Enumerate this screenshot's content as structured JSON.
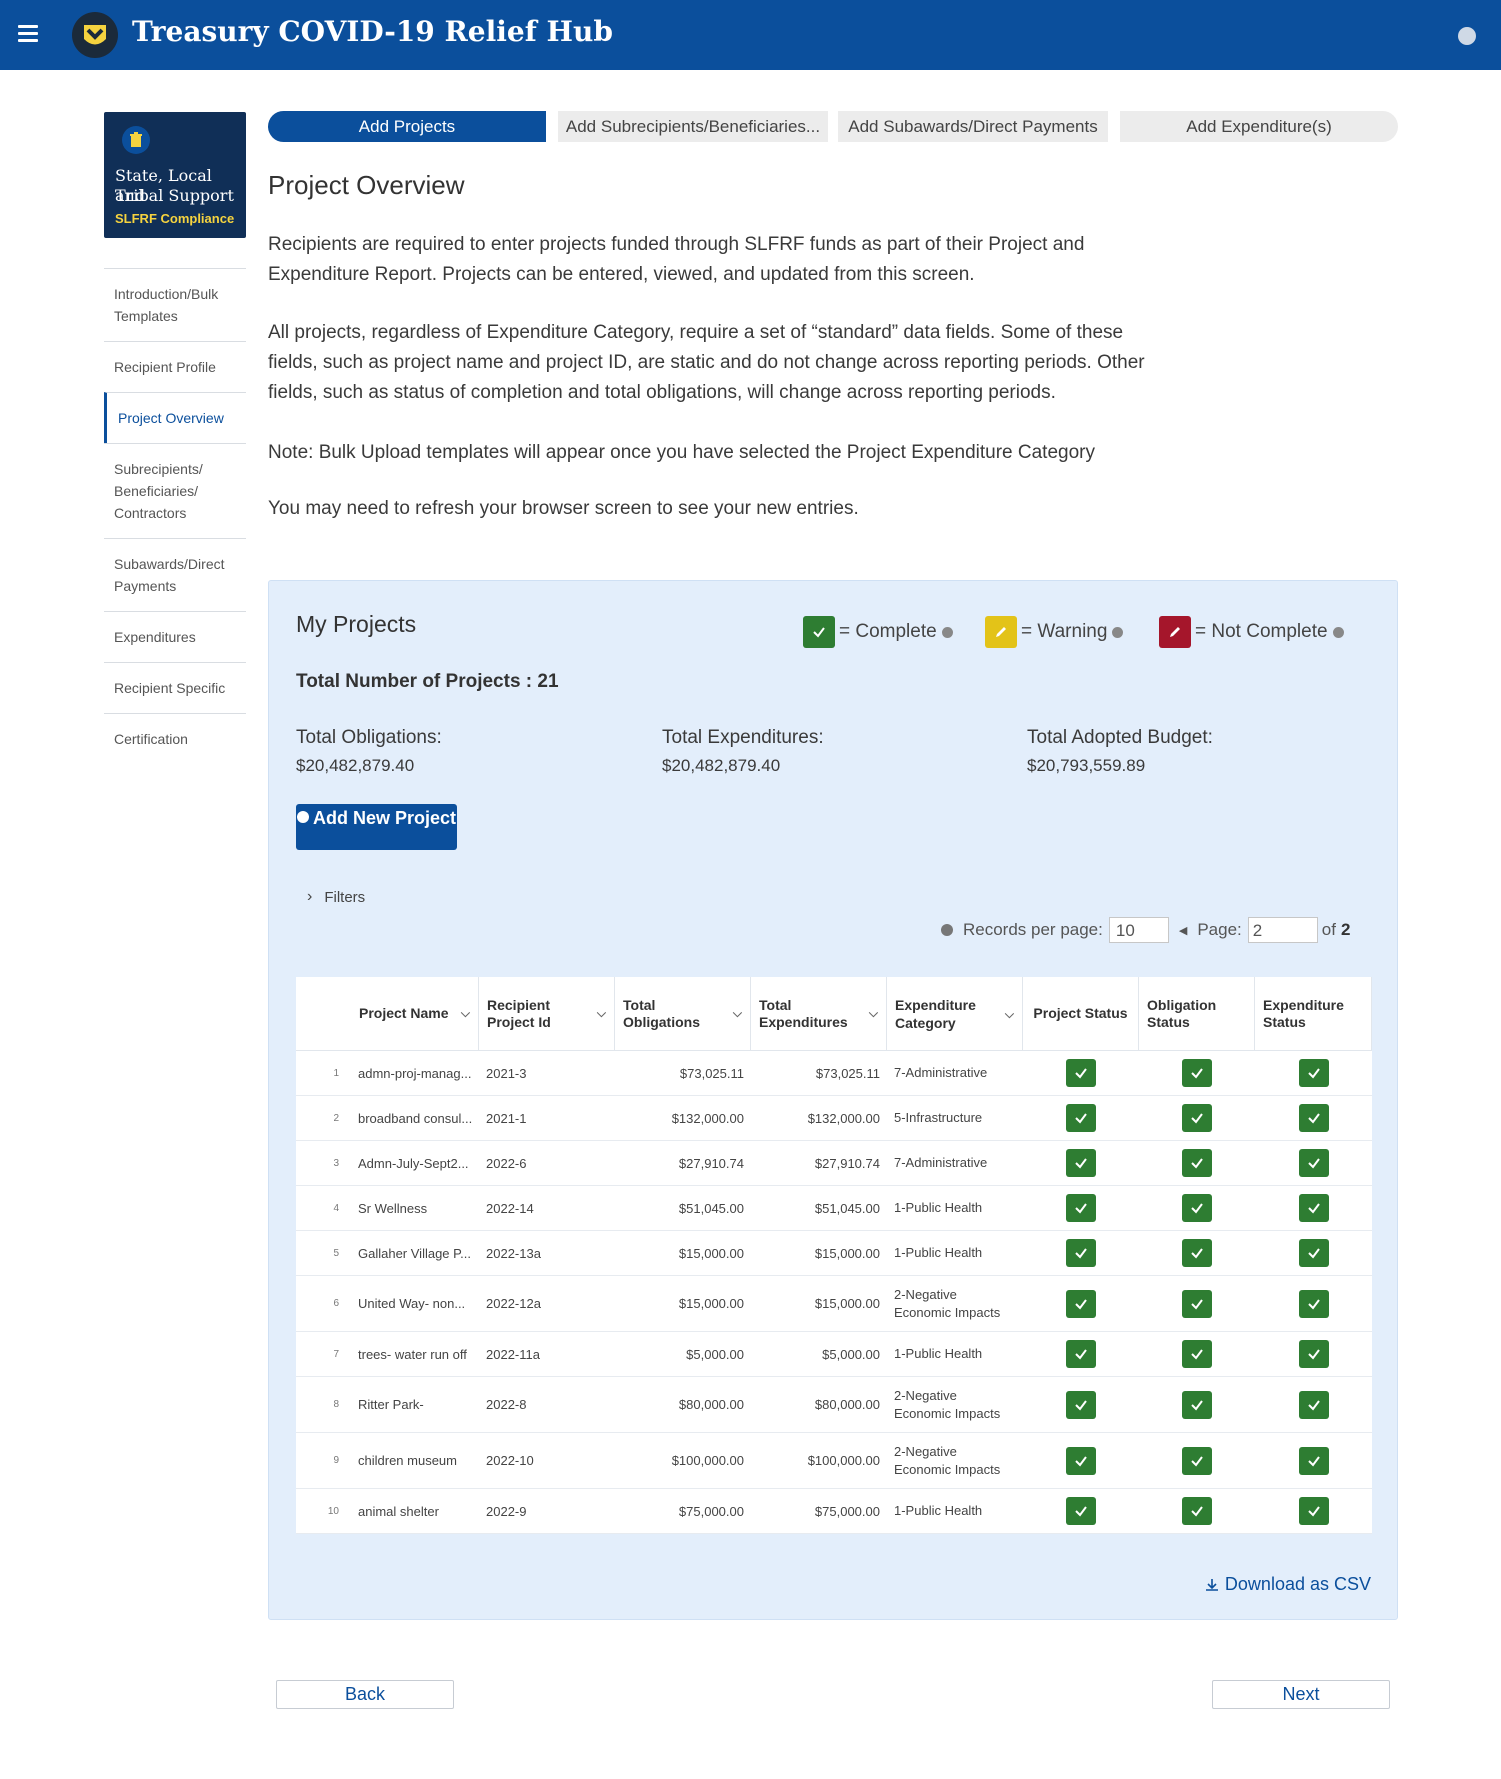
{
  "header": {
    "title": "Treasury COVID-19 Relief Hub",
    "bg": "#0b4f9c"
  },
  "sidebar": {
    "brand_line1": "State, Local and",
    "brand_line2": "Tribal Support",
    "brand_line3": "SLFRF Compliance",
    "items": [
      {
        "label": "Introduction/Bulk Templates"
      },
      {
        "label": "Recipient Profile"
      },
      {
        "label": "Project Overview"
      },
      {
        "label": "Subrecipients/ Beneficiaries/ Contractors"
      },
      {
        "label": "Subawards/Direct Payments"
      },
      {
        "label": "Expenditures"
      },
      {
        "label": "Recipient Specific"
      },
      {
        "label": "Certification"
      }
    ]
  },
  "tabs": [
    {
      "label": "Add Projects"
    },
    {
      "label": "Add Subrecipients/Beneficiaries..."
    },
    {
      "label": "Add Subawards/Direct Payments"
    },
    {
      "label": "Add Expenditure(s)"
    }
  ],
  "overview": {
    "title": "Project Overview",
    "p1": "Recipients are required to enter projects funded through SLFRF funds as part of their Project and Expenditure Report. Projects can be entered, viewed, and updated from this screen.",
    "p2": "All projects, regardless of Expenditure Category, require a set of “standard” data fields. Some of these fields, such as project name and project ID, are static and do not change across reporting periods. Other fields, such as status of completion and total obligations, will change across reporting periods.",
    "p3": "Note: Bulk Upload templates will appear once you have selected the Project Expenditure Category",
    "p4": "You may need to refresh your browser screen to see your new entries."
  },
  "projects": {
    "title": "My Projects",
    "legend": {
      "complete": "= Complete",
      "warning": "= Warning",
      "not_complete": "= Not Complete"
    },
    "total_count": "Total Number of Projects : 21",
    "totals": {
      "obligations_label": "Total Obligations:",
      "obligations_value": "$20,482,879.40",
      "expenditures_label": "Total Expenditures:",
      "expenditures_value": "$20,482,879.40",
      "budget_label": "Total Adopted Budget:",
      "budget_value": "$20,793,559.89"
    },
    "add_button": "Add New Project",
    "filters": "Filters",
    "pager": {
      "records_label": "Records per page:",
      "records_value": "10",
      "page_label": "Page:",
      "page_value": "2",
      "of": "of",
      "total_pages": "2"
    },
    "columns": {
      "name": "Project Name",
      "recipient_id": "Recipient Project Id",
      "obligations": "Total Obligations",
      "expenditures": "Total Expenditures",
      "category": "Expenditure Category",
      "project_status": "Project Status",
      "obligation_status": "Obligation Status",
      "expenditure_status": "Expenditure Status"
    },
    "rows": [
      {
        "n": "1",
        "name": "admn-proj-manag...",
        "id": "2021-3",
        "obl": "$73,025.11",
        "exp": "$73,025.11",
        "cat": "7-Administrative"
      },
      {
        "n": "2",
        "name": "broadband consul...",
        "id": "2021-1",
        "obl": "$132,000.00",
        "exp": "$132,000.00",
        "cat": "5-Infrastructure"
      },
      {
        "n": "3",
        "name": "Admn-July-Sept2...",
        "id": "2022-6",
        "obl": "$27,910.74",
        "exp": "$27,910.74",
        "cat": "7-Administrative"
      },
      {
        "n": "4",
        "name": "Sr Wellness",
        "id": "2022-14",
        "obl": "$51,045.00",
        "exp": "$51,045.00",
        "cat": "1-Public Health"
      },
      {
        "n": "5",
        "name": "Gallaher Village P...",
        "id": "2022-13a",
        "obl": "$15,000.00",
        "exp": "$15,000.00",
        "cat": "1-Public Health"
      },
      {
        "n": "6",
        "name": "United Way- non...",
        "id": "2022-12a",
        "obl": "$15,000.00",
        "exp": "$15,000.00",
        "cat": "2-Negative Economic Impacts"
      },
      {
        "n": "7",
        "name": "trees- water run off",
        "id": "2022-11a",
        "obl": "$5,000.00",
        "exp": "$5,000.00",
        "cat": "1-Public Health"
      },
      {
        "n": "8",
        "name": "Ritter Park-",
        "id": "2022-8",
        "obl": "$80,000.00",
        "exp": "$80,000.00",
        "cat": "2-Negative Economic Impacts"
      },
      {
        "n": "9",
        "name": "children museum",
        "id": "2022-10",
        "obl": "$100,000.00",
        "exp": "$100,000.00",
        "cat": "2-Negative Economic Impacts"
      },
      {
        "n": "10",
        "name": "animal shelter",
        "id": "2022-9",
        "obl": "$75,000.00",
        "exp": "$75,000.00",
        "cat": "1-Public Health"
      }
    ],
    "download": "Download as CSV"
  },
  "footer": {
    "back": "Back",
    "next": "Next"
  },
  "colors": {
    "primary": "#0b4f9c",
    "complete": "#2e7d32",
    "warning": "#e3c318",
    "not_complete": "#a5162b",
    "panel_bg": "#e3eefb"
  }
}
